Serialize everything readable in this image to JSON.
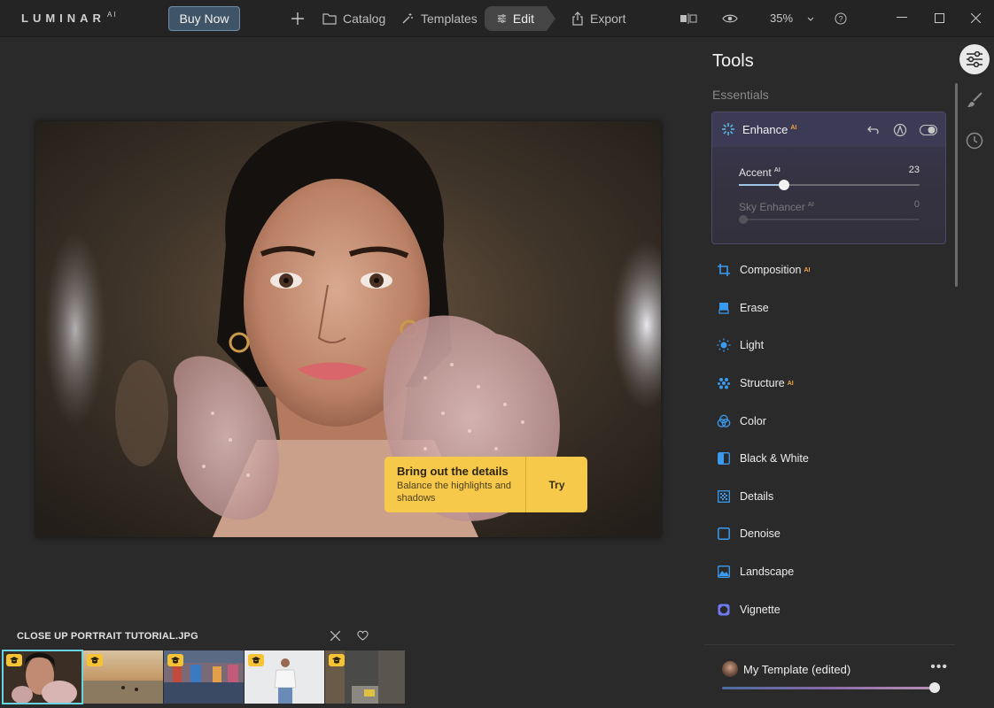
{
  "app": {
    "logo": "LUMINAR",
    "logo_sup": "AI"
  },
  "topbar": {
    "buy_label": "Buy Now",
    "catalog_label": "Catalog",
    "templates_label": "Templates",
    "edit_label": "Edit",
    "export_label": "Export",
    "zoom": "35%"
  },
  "tip": {
    "title": "Bring out the details",
    "subtitle": "Balance the highlights and shadows",
    "action": "Try"
  },
  "filmstrip": {
    "file_name": "CLOSE UP PORTRAIT TUTORIAL.JPG"
  },
  "panel": {
    "title": "Tools",
    "section": "Essentials",
    "enhance": {
      "label": "Enhance",
      "ai": "AI",
      "accent_label": "Accent",
      "accent_value": "23",
      "accent_fraction": 0.25,
      "sky_label": "Sky Enhancer",
      "sky_value": "0",
      "sky_fraction": 0.03
    },
    "tools": [
      {
        "label": "Composition",
        "ai": "AI",
        "icon": "crop-icon",
        "color": "#3a9bf0"
      },
      {
        "label": "Erase",
        "ai": "",
        "icon": "eraser-icon",
        "color": "#3a9bf0"
      },
      {
        "label": "Light",
        "ai": "",
        "icon": "sun-icon",
        "color": "#3a9bf0"
      },
      {
        "label": "Structure",
        "ai": "AI",
        "icon": "structure-icon",
        "color": "#3a9bf0"
      },
      {
        "label": "Color",
        "ai": "",
        "icon": "color-circles-icon",
        "color": "#3a9bf0"
      },
      {
        "label": "Black & White",
        "ai": "",
        "icon": "half-square-icon",
        "color": "#3a9bf0"
      },
      {
        "label": "Details",
        "ai": "",
        "icon": "details-grid-icon",
        "color": "#3a9bf0"
      },
      {
        "label": "Denoise",
        "ai": "",
        "icon": "denoise-square-icon",
        "color": "#3a9bf0"
      },
      {
        "label": "Landscape",
        "ai": "",
        "icon": "landscape-icon",
        "color": "#3a9bf0"
      },
      {
        "label": "Vignette",
        "ai": "",
        "icon": "vignette-icon",
        "color": "#6f7bf2"
      }
    ],
    "template": {
      "name": "My Template (edited)",
      "more": "•••",
      "amount_fraction": 1.0
    }
  }
}
